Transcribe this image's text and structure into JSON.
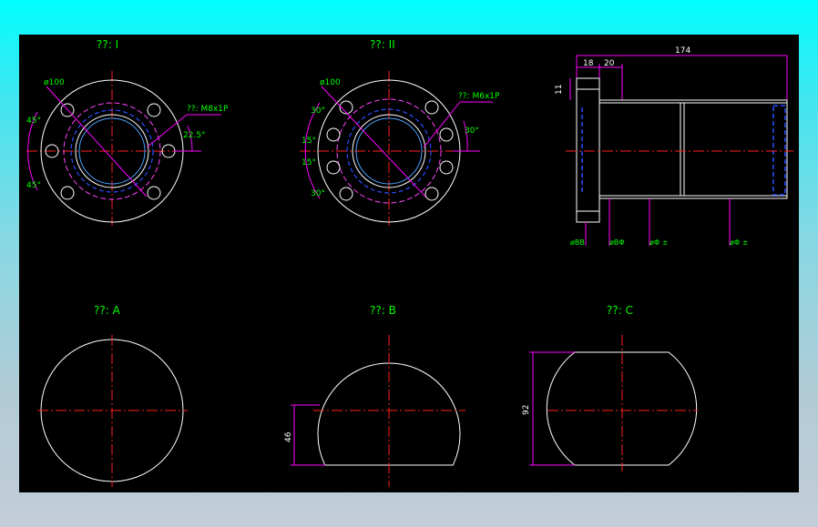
{
  "colors": {
    "background": "#000000",
    "outline": "#ffffff",
    "centerline": "#ff2020",
    "hidden": "#2b4dff",
    "dimension": "#ff00ff",
    "title": "#00ff00",
    "note": "#00ff00",
    "pitch": "#ff44ff"
  },
  "views": {
    "view1": {
      "title": "??: I",
      "dia_label": "ø100",
      "callout": "??: M8x1P",
      "angle_top": "45°",
      "angle_bottom": "45°",
      "angle_right": "22.5°"
    },
    "view2": {
      "title": "??: II",
      "dia_label": "ø100",
      "callout": "??: M6x1P",
      "angle_top_left": "30°",
      "angle_mid_upper": "15°",
      "angle_mid_lower": "15°",
      "angle_bottom_left": "30°",
      "angle_right": "30°"
    },
    "side": {
      "dim_overall": "174",
      "dim_flange": "18",
      "dim_step": "20",
      "dim_thickness": "11",
      "dia1": "øBB",
      "dia2": "øBΦ",
      "dia3": "øΦ ±",
      "dia4": "øΦ ±"
    },
    "viewA": {
      "title": "??: A"
    },
    "viewB": {
      "title": "??: B",
      "dim_flat": "46"
    },
    "viewC": {
      "title": "??: C",
      "dim_width": "92"
    }
  }
}
